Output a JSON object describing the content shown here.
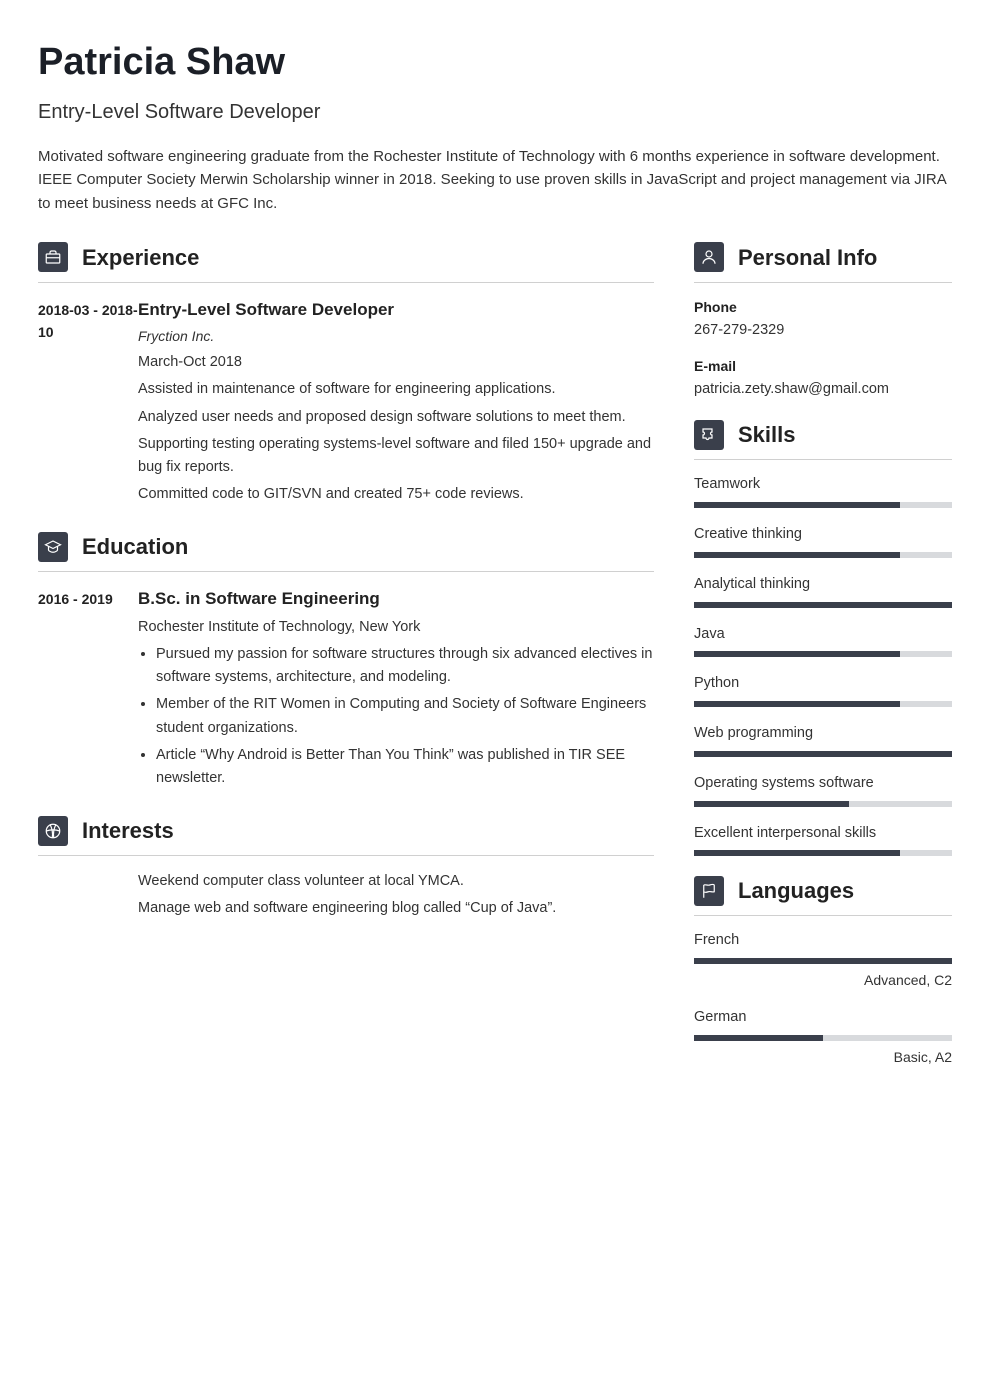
{
  "name": "Patricia Shaw",
  "title": "Entry-Level Software Developer",
  "summary": "Motivated software engineering graduate from the Rochester Institute of Technology with 6 months experience in software development. IEEE Computer Society Merwin Scholarship winner in 2018. Seeking to use proven skills in JavaScript and project management via JIRA to meet business needs at GFC Inc.",
  "sections": {
    "experience": "Experience",
    "education": "Education",
    "interests": "Interests",
    "personal_info": "Personal Info",
    "skills": "Skills",
    "languages": "Languages"
  },
  "experience": [
    {
      "dates": "2018-03 - 2018-10",
      "title": "Entry-Level Software Developer",
      "company": "Fryction Inc.",
      "period": "March-Oct 2018",
      "lines": [
        "Assisted in maintenance of software for engineering applications.",
        "Analyzed user needs and proposed design software solutions to meet them.",
        "Supporting testing operating systems-level software and filed 150+ upgrade and bug fix reports.",
        "Committed code to GIT/SVN and created 75+ code reviews."
      ]
    }
  ],
  "education": [
    {
      "dates": "2016 - 2019",
      "title": "B.Sc. in Software Engineering",
      "school": "Rochester Institute of Technology, New York",
      "bullets": [
        "Pursued my passion for software structures through six advanced electives in software systems, architecture, and modeling.",
        "Member of the RIT Women in Computing and Society of Software Engineers student organizations.",
        "Article “Why Android is Better Than You Think” was published in TIR SEE newsletter."
      ]
    }
  ],
  "interests": [
    "Weekend computer class volunteer at local YMCA.",
    "Manage web and software engineering blog called “Cup of Java”."
  ],
  "personal_info": {
    "phone_label": "Phone",
    "phone": "267-279-2329",
    "email_label": "E-mail",
    "email": "patricia.zety.shaw@gmail.com"
  },
  "skills": [
    {
      "name": "Teamwork",
      "level": 80
    },
    {
      "name": "Creative thinking",
      "level": 80
    },
    {
      "name": "Analytical thinking",
      "level": 100
    },
    {
      "name": "Java",
      "level": 80
    },
    {
      "name": "Python",
      "level": 80
    },
    {
      "name": "Web programming",
      "level": 100
    },
    {
      "name": "Operating systems software",
      "level": 60
    },
    {
      "name": "Excellent interpersonal skills",
      "level": 80
    }
  ],
  "languages": [
    {
      "name": "French",
      "level": 100,
      "label": "Advanced, C2"
    },
    {
      "name": "German",
      "level": 50,
      "label": "Basic, A2"
    }
  ]
}
